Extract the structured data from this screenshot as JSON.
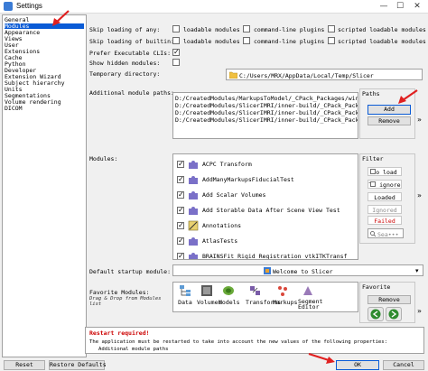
{
  "window": {
    "title": "Settings",
    "minimize": "—",
    "maximize": "☐",
    "close": "✕"
  },
  "nav": {
    "items": [
      {
        "label": "General",
        "selected": false
      },
      {
        "label": "Modules",
        "selected": true
      },
      {
        "label": "Appearance",
        "selected": false
      },
      {
        "label": "Views",
        "selected": false
      },
      {
        "label": "User",
        "selected": false
      },
      {
        "label": "Extensions",
        "selected": false
      },
      {
        "label": "Cache",
        "selected": false
      },
      {
        "label": "Python",
        "selected": false
      },
      {
        "label": "Developer",
        "selected": false
      },
      {
        "label": "Extension Wizard",
        "selected": false
      },
      {
        "label": "Subject hierarchy",
        "selected": false
      },
      {
        "label": "Units",
        "selected": false
      },
      {
        "label": "Segmentations",
        "selected": false
      },
      {
        "label": "Volume rendering",
        "selected": false
      },
      {
        "label": "DICOM",
        "selected": false
      }
    ]
  },
  "settings": {
    "skip_any_label": "Skip loading of any:",
    "skip_builtin_label": "Skip loading of builtin:",
    "opt_loadable": "loadable modules",
    "opt_cli": "command-line plugins",
    "opt_scripted": "scripted loadable modules",
    "prefer_cli_label": "Prefer Executable CLIs:",
    "prefer_cli_checked": true,
    "show_hidden_label": "Show hidden modules:",
    "temp_dir_label": "Temporary directory:",
    "temp_dir_value": "C:/Users/MRX/AppData/Local/Temp/Slicer",
    "paths_label": "Additional module paths:",
    "paths": [
      "D:/CreatedModules/MarkupsToModel/_CPack_Packages/win64",
      "D:/CreatedModules/SlicerIMRI/inner-build/_CPack_Package",
      "D:/CreatedModules/SlicerIMRI/inner-build/_CPack_Package",
      "D:/CreatedModules/SlicerIMRI/inner-build/_CPack_Package"
    ],
    "paths_group_title": "Paths",
    "add_button": "Add",
    "remove_button": "Remove",
    "more_glyph": "»"
  },
  "modules": {
    "label": "Modules:",
    "items": [
      {
        "name": "ACPC Transform",
        "checked": true
      },
      {
        "name": "AddManyMarkupsFiducialTest",
        "checked": true
      },
      {
        "name": "Add Scalar Volumes",
        "checked": true
      },
      {
        "name": "Add Storable Data After Scene View Test",
        "checked": true
      },
      {
        "name": "Annotations",
        "checked": true
      },
      {
        "name": "AtlasTests",
        "checked": true
      },
      {
        "name": "BRAINSFit Rigid Registration vtkITKTransf",
        "checked": true
      }
    ],
    "filter_title": "Filter",
    "filters": [
      {
        "label": "To load",
        "checked": false,
        "color": "#000000"
      },
      {
        "label": "To ignore",
        "checked": false,
        "color": "#000000"
      },
      {
        "label": "Loaded",
        "checked": false,
        "color": "#000000"
      },
      {
        "label": "Ignored",
        "checked": false,
        "color": "#8a8a8a"
      },
      {
        "label": "Failed",
        "checked": false,
        "color": "#cc0000"
      }
    ],
    "search_placeholder": "Sea•••"
  },
  "startup": {
    "label": "Default startup module:",
    "value": "Welcome to Slicer"
  },
  "favorites": {
    "label": "Favorite Modules:",
    "hint": "Drag & Drop from Modules list",
    "items": [
      {
        "label": "Data",
        "color": "#5d9bd5"
      },
      {
        "label": "Volumes",
        "color": "#5a5a5a"
      },
      {
        "label": "Models",
        "color": "#6aaa3a"
      },
      {
        "label": "Transforms",
        "color": "#7a5ca8"
      },
      {
        "label": "Markups",
        "color": "#d9473b"
      },
      {
        "label": "Segment Editor",
        "color": "#9a7ab8"
      }
    ],
    "group_title": "Favorite",
    "remove_button": "Remove"
  },
  "restart": {
    "title": "Restart required!",
    "message": "The application must be restarted to take into account the new values of the following properties:",
    "item": "Additional module paths"
  },
  "footer": {
    "reset": "Reset",
    "restore": "Restore Defaults",
    "ok": "OK",
    "cancel": "Cancel"
  },
  "colors": {
    "accent": "#0a5bd6",
    "annotation_arrow": "#e02020",
    "error": "#cc0000"
  }
}
